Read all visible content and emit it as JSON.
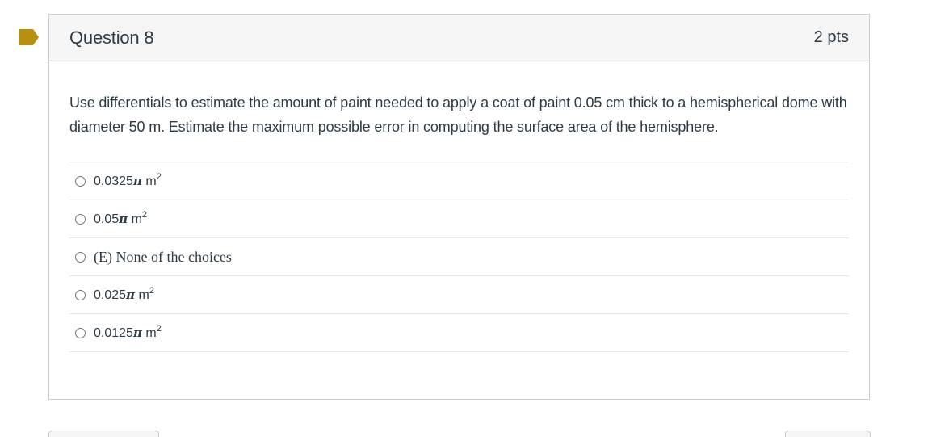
{
  "question": {
    "title": "Question 8",
    "points": "2 pts",
    "text": "Use differentials to estimate the amount of paint needed to apply a coat of paint 0.05 cm thick to a hemispherical dome with diameter 50 m. Estimate the maximum possible error in computing the surface area of the hemisphere.",
    "flag_color": "#b8900f",
    "answers": [
      {
        "value": "0.0325",
        "symbol": "π",
        "unit": "m",
        "exp": "2",
        "style": "math"
      },
      {
        "value": "0.05",
        "symbol": "π",
        "unit": "m",
        "exp": "2",
        "style": "math"
      },
      {
        "value": "(E) None of the choices",
        "style": "serif"
      },
      {
        "value": "0.025",
        "symbol": "π",
        "unit": "m",
        "exp": "2",
        "style": "math"
      },
      {
        "value": "0.0125",
        "symbol": "π",
        "unit": "m",
        "exp": "2",
        "style": "math"
      }
    ]
  }
}
